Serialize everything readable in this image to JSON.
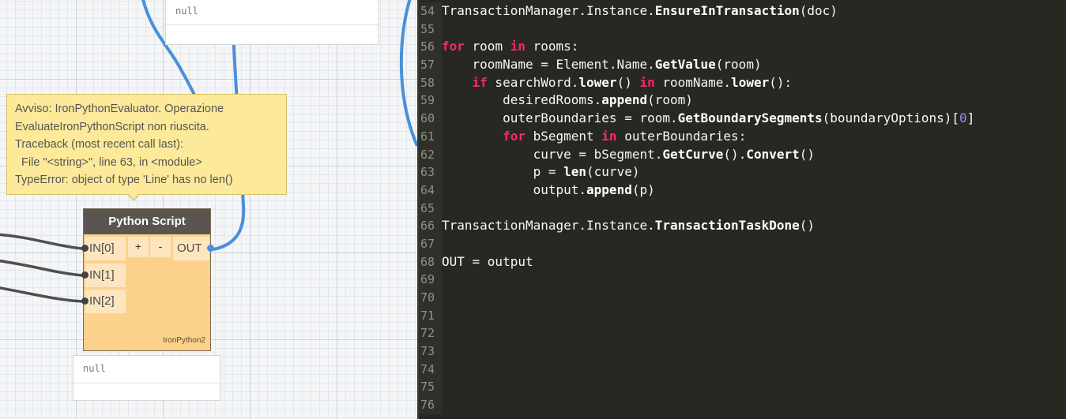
{
  "canvas": {
    "top_preview": {
      "value": "null"
    },
    "bottom_preview": {
      "value": "null"
    },
    "warning": {
      "lines": [
        "Avviso: IronPythonEvaluator. Operazione",
        "EvaluateIronPythonScript non riuscita.",
        "Traceback (most recent call last):",
        "  File \"<string>\", line 63, in <module>",
        "TypeError: object of type 'Line' has no len()"
      ]
    },
    "node": {
      "title": "Python Script",
      "inputs": [
        "IN[0]",
        "IN[1]",
        "IN[2]"
      ],
      "add_label": "+",
      "remove_label": "-",
      "output": "OUT",
      "engine": "IronPython2"
    },
    "colors": {
      "wire_blue": "#4a90d9",
      "node_body": "#fcd18b",
      "node_header": "#5a5550",
      "warning_bg": "#fde99a"
    }
  },
  "editor": {
    "lines": [
      {
        "n": "54",
        "tokens": [
          [
            "",
            "TransactionManager.Instance."
          ],
          [
            "fn",
            "EnsureInTransaction"
          ],
          [
            "",
            "(doc)"
          ]
        ]
      },
      {
        "n": "55",
        "tokens": []
      },
      {
        "n": "56",
        "tokens": [
          [
            "kw",
            "for"
          ],
          [
            "",
            " room "
          ],
          [
            "kw",
            "in"
          ],
          [
            "",
            " rooms:"
          ]
        ]
      },
      {
        "n": "57",
        "tokens": [
          [
            "",
            "    roomName = Element.Name."
          ],
          [
            "fn",
            "GetValue"
          ],
          [
            "",
            "(room)"
          ]
        ]
      },
      {
        "n": "58",
        "tokens": [
          [
            "",
            "    "
          ],
          [
            "kw",
            "if"
          ],
          [
            "",
            " searchWord."
          ],
          [
            "fn",
            "lower"
          ],
          [
            "",
            "() "
          ],
          [
            "kw",
            "in"
          ],
          [
            "",
            " roomName."
          ],
          [
            "fn",
            "lower"
          ],
          [
            "",
            "():"
          ]
        ]
      },
      {
        "n": "59",
        "tokens": [
          [
            "",
            "        desiredRooms."
          ],
          [
            "fn",
            "append"
          ],
          [
            "",
            "(room)"
          ]
        ]
      },
      {
        "n": "60",
        "tokens": [
          [
            "",
            "        outerBoundaries = room."
          ],
          [
            "fn",
            "GetBoundarySegments"
          ],
          [
            "",
            "(boundaryOptions)["
          ],
          [
            "num",
            "0"
          ],
          [
            "",
            "]"
          ]
        ]
      },
      {
        "n": "61",
        "tokens": [
          [
            "",
            "        "
          ],
          [
            "kw",
            "for"
          ],
          [
            "",
            " bSegment "
          ],
          [
            "kw",
            "in"
          ],
          [
            "",
            " outerBoundaries:"
          ]
        ]
      },
      {
        "n": "62",
        "tokens": [
          [
            "",
            "            curve = bSegment."
          ],
          [
            "fn",
            "GetCurve"
          ],
          [
            "",
            "()."
          ],
          [
            "fn",
            "Convert"
          ],
          [
            "",
            "()"
          ]
        ]
      },
      {
        "n": "63",
        "tokens": [
          [
            "",
            "            p = "
          ],
          [
            "fn",
            "len"
          ],
          [
            "",
            "(curve)"
          ]
        ]
      },
      {
        "n": "64",
        "tokens": [
          [
            "",
            "            output."
          ],
          [
            "fn",
            "append"
          ],
          [
            "",
            "(p)"
          ]
        ]
      },
      {
        "n": "65",
        "tokens": []
      },
      {
        "n": "66",
        "tokens": [
          [
            "",
            "TransactionManager.Instance."
          ],
          [
            "fn",
            "TransactionTaskDone"
          ],
          [
            "",
            "()"
          ]
        ]
      },
      {
        "n": "67",
        "tokens": []
      },
      {
        "n": "68",
        "tokens": [
          [
            "",
            "OUT = output"
          ]
        ]
      },
      {
        "n": "69",
        "tokens": []
      },
      {
        "n": "70",
        "tokens": []
      },
      {
        "n": "71",
        "tokens": []
      },
      {
        "n": "72",
        "tokens": []
      },
      {
        "n": "73",
        "tokens": []
      },
      {
        "n": "74",
        "tokens": []
      },
      {
        "n": "75",
        "tokens": []
      },
      {
        "n": "76",
        "tokens": []
      }
    ]
  }
}
